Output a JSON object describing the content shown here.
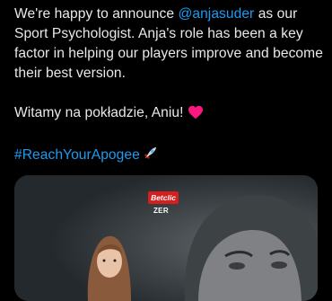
{
  "tweet": {
    "intro": "We're happy to announce ",
    "mention": "@anjasuder",
    "after_mention": "  as our Sport Psychologist. Anja's role has been a key factor in helping our players improve and become their best version.",
    "welcome": "Witamy na pokładzie, Aniu!",
    "hashtag": "#ReachYourApogee"
  },
  "media": {
    "sponsor_label": "Betclic",
    "sponsor_sub": "ZER",
    "colors": {
      "background": "#2b3236",
      "badge": "#d61e1c"
    }
  },
  "colors": {
    "text": "#e7e9ea",
    "link": "#1d9bf0",
    "heart": "#f91880"
  }
}
